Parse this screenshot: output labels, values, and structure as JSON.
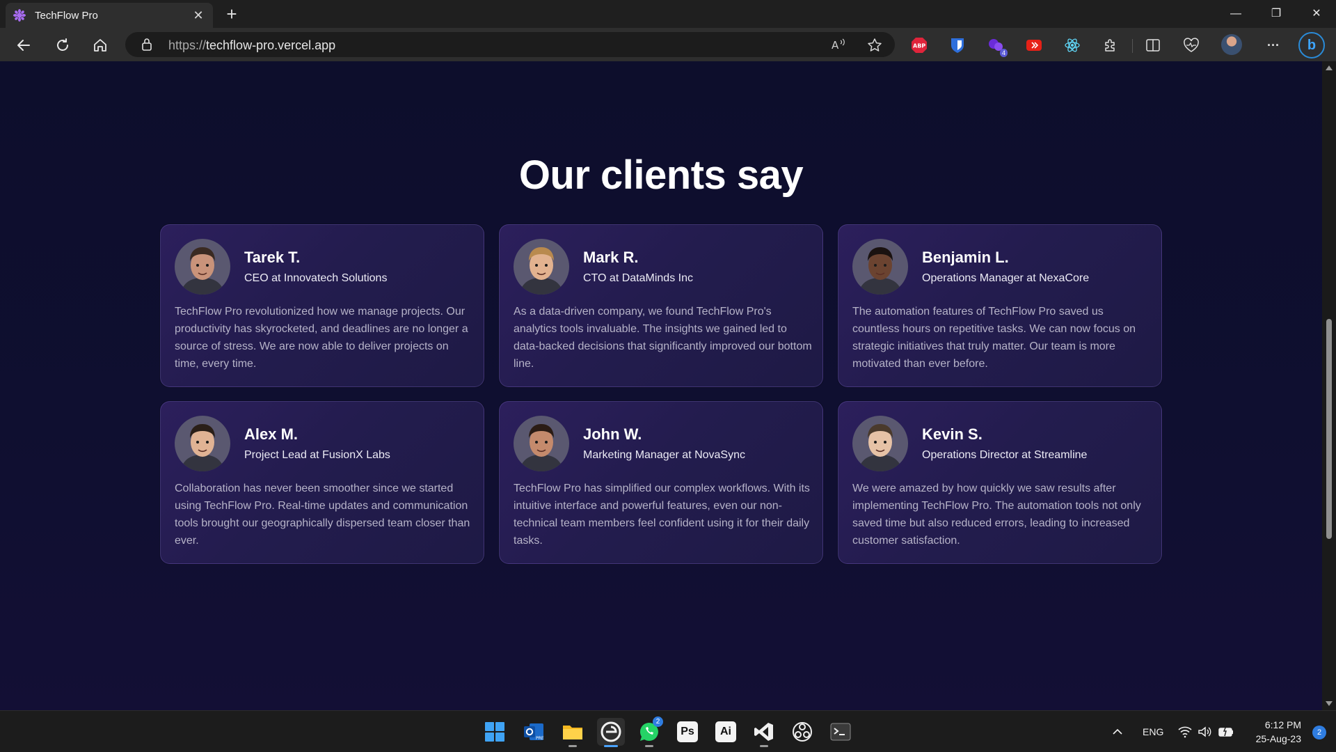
{
  "browser": {
    "tab_title": "TechFlow Pro",
    "tab_close": "✕",
    "new_tab": "+",
    "url_protocol": "https://",
    "url_host": "techflow-pro.vercel.app",
    "window": {
      "minimize": "—",
      "restore": "❐",
      "close": "✕"
    },
    "extensions": [
      "abp-icon",
      "bitwarden-icon",
      "extension-purple-icon",
      "youtube-icon",
      "react-devtools-icon",
      "puzzle-icon"
    ],
    "extension_badge": "4",
    "more": "···"
  },
  "page": {
    "heading": "Our clients say",
    "testimonials": [
      {
        "name": "Tarek T.",
        "role": "CEO at Innovatech Solutions",
        "quote": "TechFlow Pro revolutionized how we manage projects. Our productivity has skyrocketed, and deadlines are no longer a source of stress. We are now able to deliver projects on time, every time.",
        "skin": "#c9937a",
        "hair": "#3a2a22"
      },
      {
        "name": "Mark R.",
        "role": "CTO at DataMinds Inc",
        "quote": "As a data-driven company, we found TechFlow Pro's analytics tools invaluable. The insights we gained led to data-backed decisions that significantly improved our bottom line.",
        "skin": "#e2b28f",
        "hair": "#b98a4e"
      },
      {
        "name": "Benjamin L.",
        "role": "Operations Manager at NexaCore",
        "quote": "The automation features of TechFlow Pro saved us countless hours on repetitive tasks. We can now focus on strategic initiatives that truly matter. Our team is more motivated than ever before.",
        "skin": "#6b4330",
        "hair": "#1a1210"
      },
      {
        "name": "Alex M.",
        "role": "Project Lead at FusionX Labs",
        "quote": "Collaboration has never been smoother since we started using TechFlow Pro. Real-time updates and communication tools brought our geographically dispersed team closer than ever.",
        "skin": "#e0b394",
        "hair": "#2a1f18"
      },
      {
        "name": "John W.",
        "role": "Marketing Manager at NovaSync",
        "quote": "TechFlow Pro has simplified our complex workflows. With its intuitive interface and powerful features, even our non-technical team members feel confident using it for their daily tasks.",
        "skin": "#c48a6c",
        "hair": "#2b1c15"
      },
      {
        "name": "Kevin S.",
        "role": "Operations Director at Streamline",
        "quote": "We were amazed by how quickly we saw results after implementing TechFlow Pro. The automation tools not only saved time but also reduced errors, leading to increased customer satisfaction.",
        "skin": "#e6c2a6",
        "hair": "#4a3a2c"
      }
    ]
  },
  "taskbar": {
    "apps": [
      "windows-start-icon",
      "outlook-icon",
      "file-explorer-icon",
      "edge-icon",
      "whatsapp-icon",
      "photoshop-icon",
      "illustrator-icon",
      "vscode-icon",
      "obs-icon",
      "terminal-icon"
    ],
    "ps_label": "Ps",
    "ai_label": "Ai",
    "whatsapp_badge": "2",
    "language": "ENG",
    "time": "6:12 PM",
    "date": "25-Aug-23",
    "notifications": "2"
  },
  "colors": {
    "page_bg": "#0e0f2e",
    "card_bg": "#2c1f5c",
    "accent_blue": "#2f7de1"
  }
}
